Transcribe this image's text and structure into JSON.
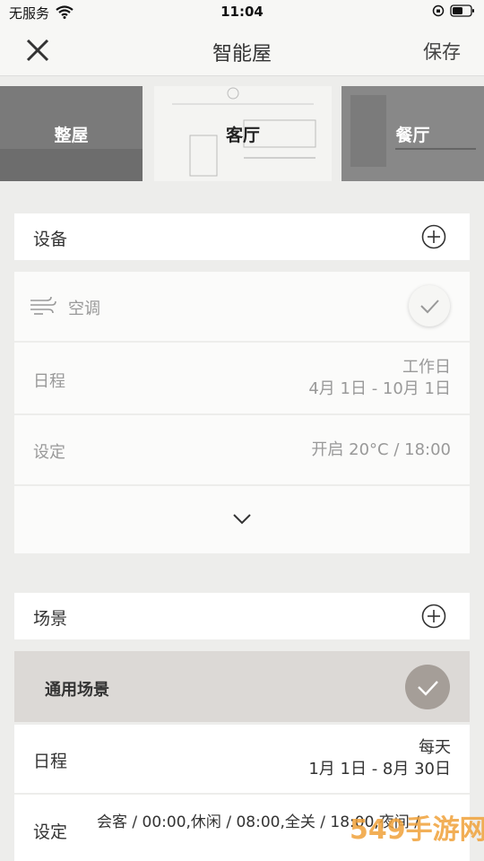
{
  "status": {
    "carrier": "无服务",
    "time": "11:04"
  },
  "nav": {
    "title": "智能屋",
    "save": "保存"
  },
  "rooms": [
    {
      "label": "整屋"
    },
    {
      "label": "客厅"
    },
    {
      "label": "餐厅"
    }
  ],
  "devices": {
    "header": "设备",
    "device_name": "空调",
    "schedule_label": "日程",
    "schedule_days": "工作日",
    "schedule_range": "4月 1日 - 10月 1日",
    "setting_label": "设定",
    "setting_value": "开启 20°C / 18:00"
  },
  "scenes": {
    "header": "场景",
    "scene_name": "通用场景",
    "schedule_label": "日程",
    "schedule_days": "每天",
    "schedule_range": "1月 1日 - 8月 30日",
    "setting_label": "设定",
    "setting_value": "会客 / 00:00,休闲 / 08:00,全关 / 18:00,夜间 /"
  },
  "watermark": "549手游网"
}
